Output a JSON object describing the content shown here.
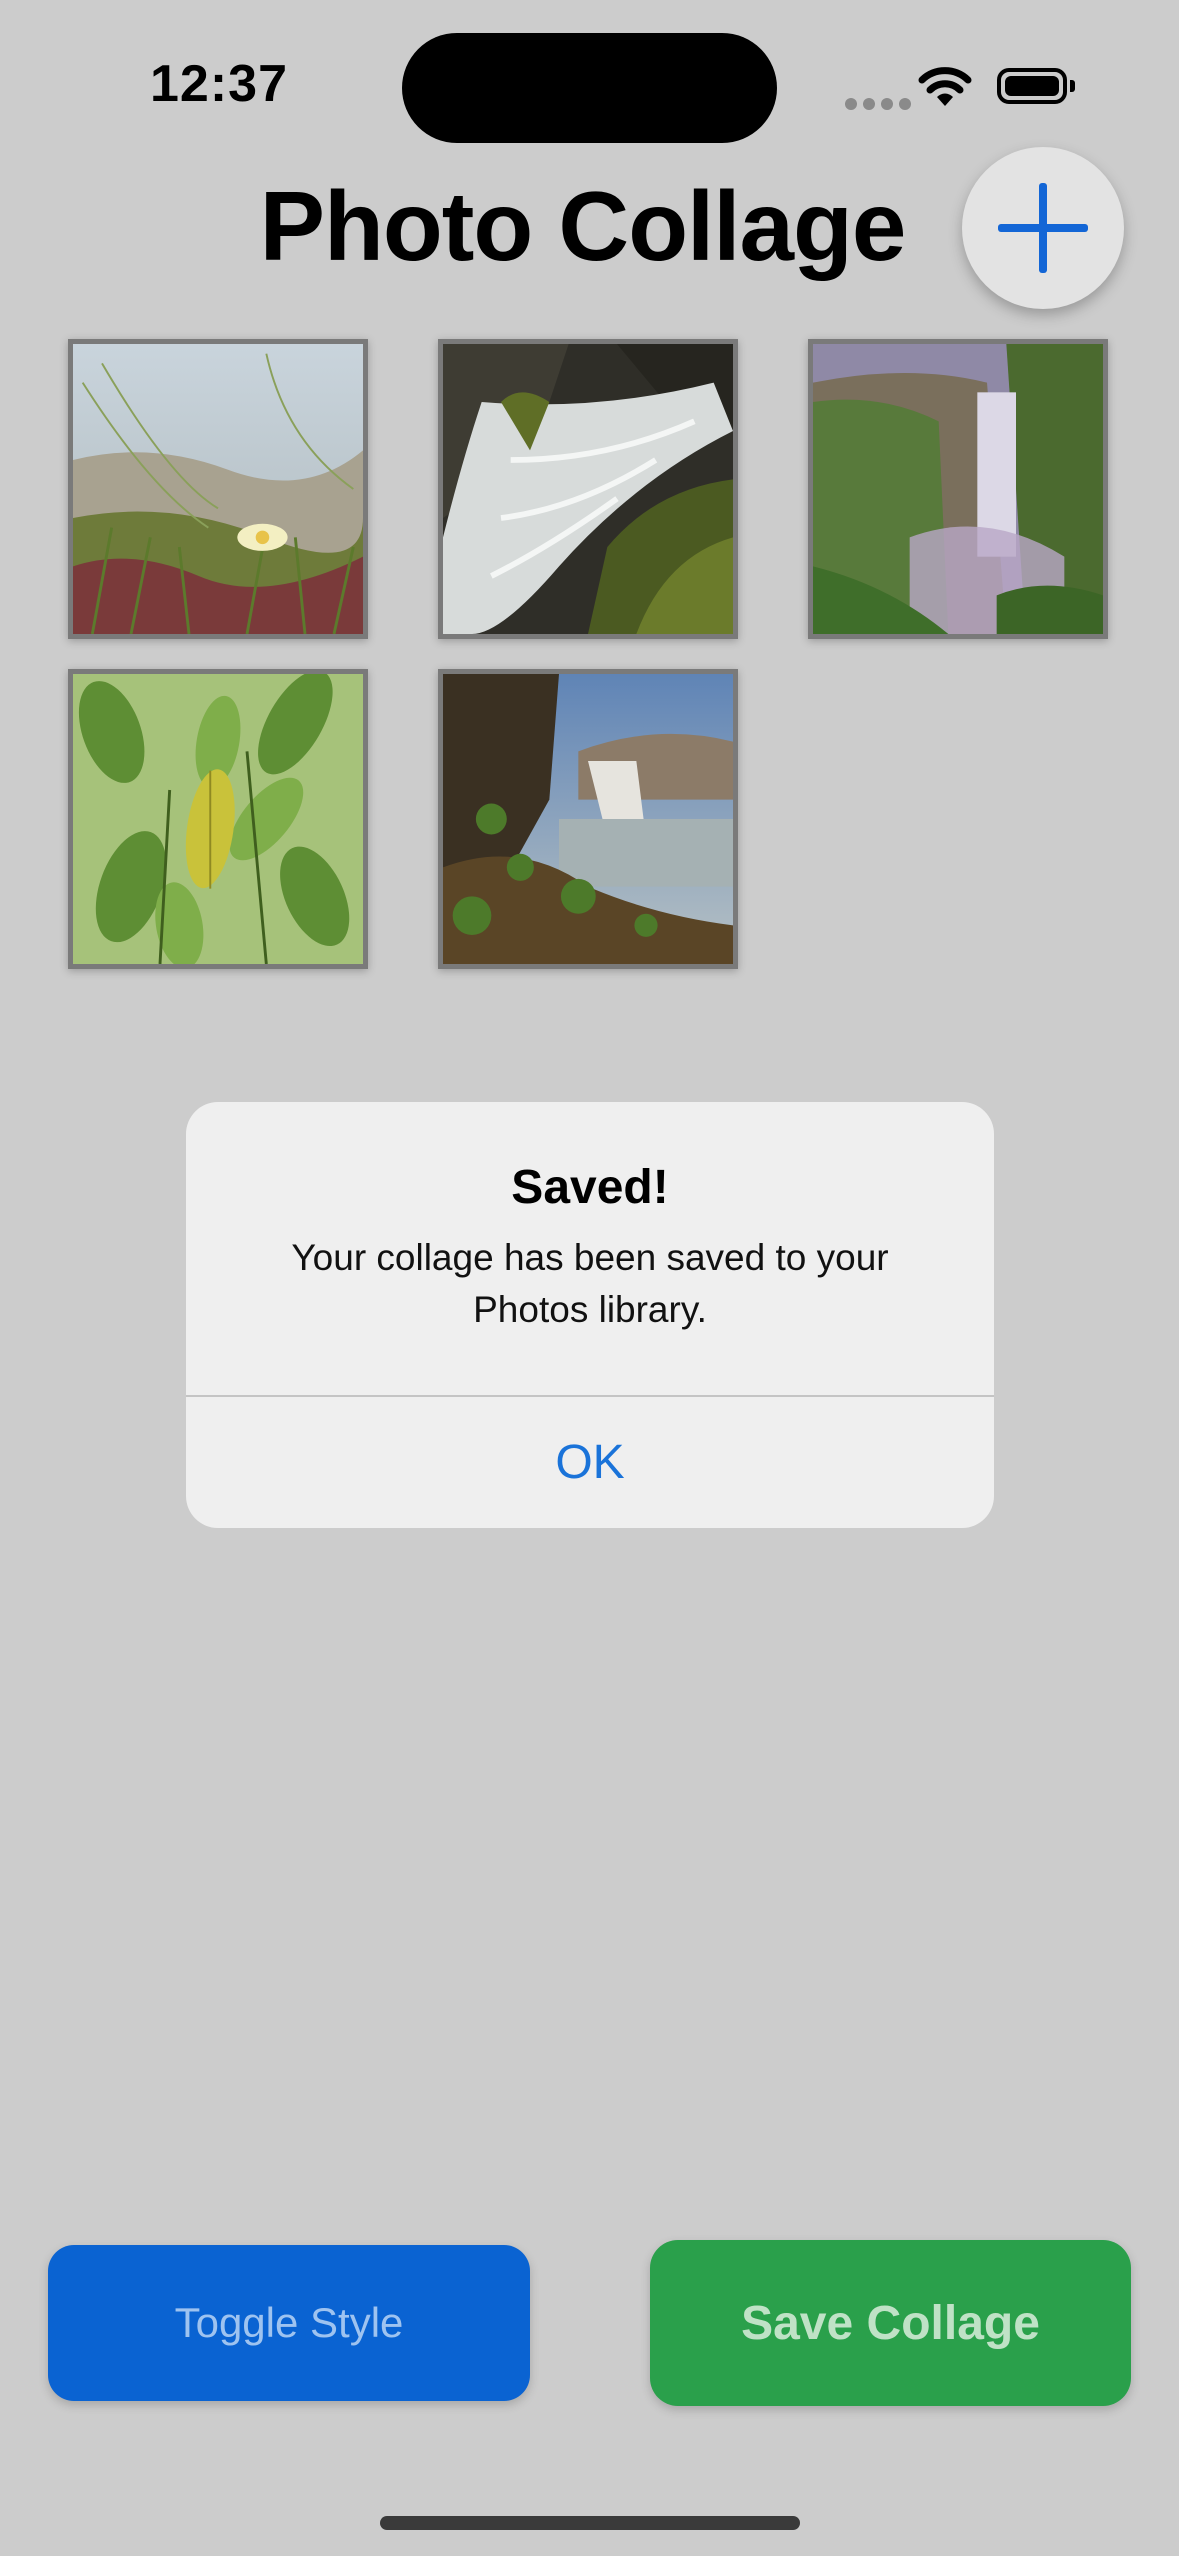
{
  "status_bar": {
    "time": "12:37"
  },
  "header": {
    "title": "Photo Collage",
    "add_icon": "plus-icon"
  },
  "photos": [
    {
      "subject": "dune grass with yellow flower"
    },
    {
      "subject": "waterfall over mossy rocks"
    },
    {
      "subject": "waterfall in misty valley"
    },
    {
      "subject": "green leaves"
    },
    {
      "subject": "waterfall at sunset with rocky shore"
    }
  ],
  "alert": {
    "title": "Saved!",
    "message": "Your collage has been saved to your Photos library.",
    "ok_label": "OK"
  },
  "buttons": {
    "toggle_label": "Toggle Style",
    "save_label": "Save Collage"
  },
  "colors": {
    "accent_blue": "#0a63d2",
    "save_green": "#2aa04b",
    "link_blue": "#1a73d9",
    "background": "#cccccc"
  }
}
